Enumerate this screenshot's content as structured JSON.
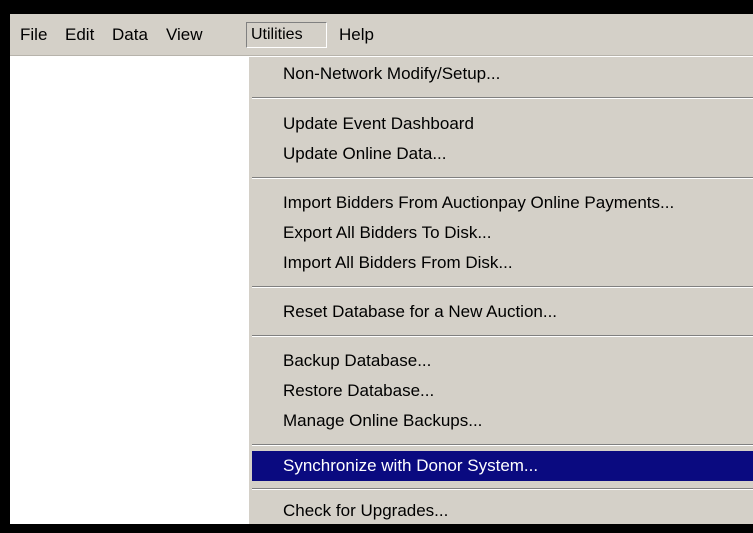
{
  "menubar": {
    "items": [
      {
        "label": "File"
      },
      {
        "label": "Edit"
      },
      {
        "label": "Data"
      },
      {
        "label": "View"
      },
      {
        "label": "Utilities"
      },
      {
        "label": "Help"
      }
    ]
  },
  "utilities_menu": {
    "items": [
      {
        "label": "Non-Network Modify/Setup..."
      },
      {
        "label": "Update Event Dashboard"
      },
      {
        "label": "Update Online Data..."
      },
      {
        "label": "Import Bidders From Auctionpay Online Payments..."
      },
      {
        "label": "Export All Bidders To Disk..."
      },
      {
        "label": "Import All Bidders From Disk..."
      },
      {
        "label": "Reset Database for a New Auction..."
      },
      {
        "label": "Backup Database..."
      },
      {
        "label": "Restore Database..."
      },
      {
        "label": "Manage Online Backups..."
      },
      {
        "label": "Synchronize with Donor System..."
      },
      {
        "label": "Check for Upgrades..."
      }
    ],
    "highlighted_item": "Synchronize with Donor System...",
    "highlight_color": "#0a0a80"
  }
}
